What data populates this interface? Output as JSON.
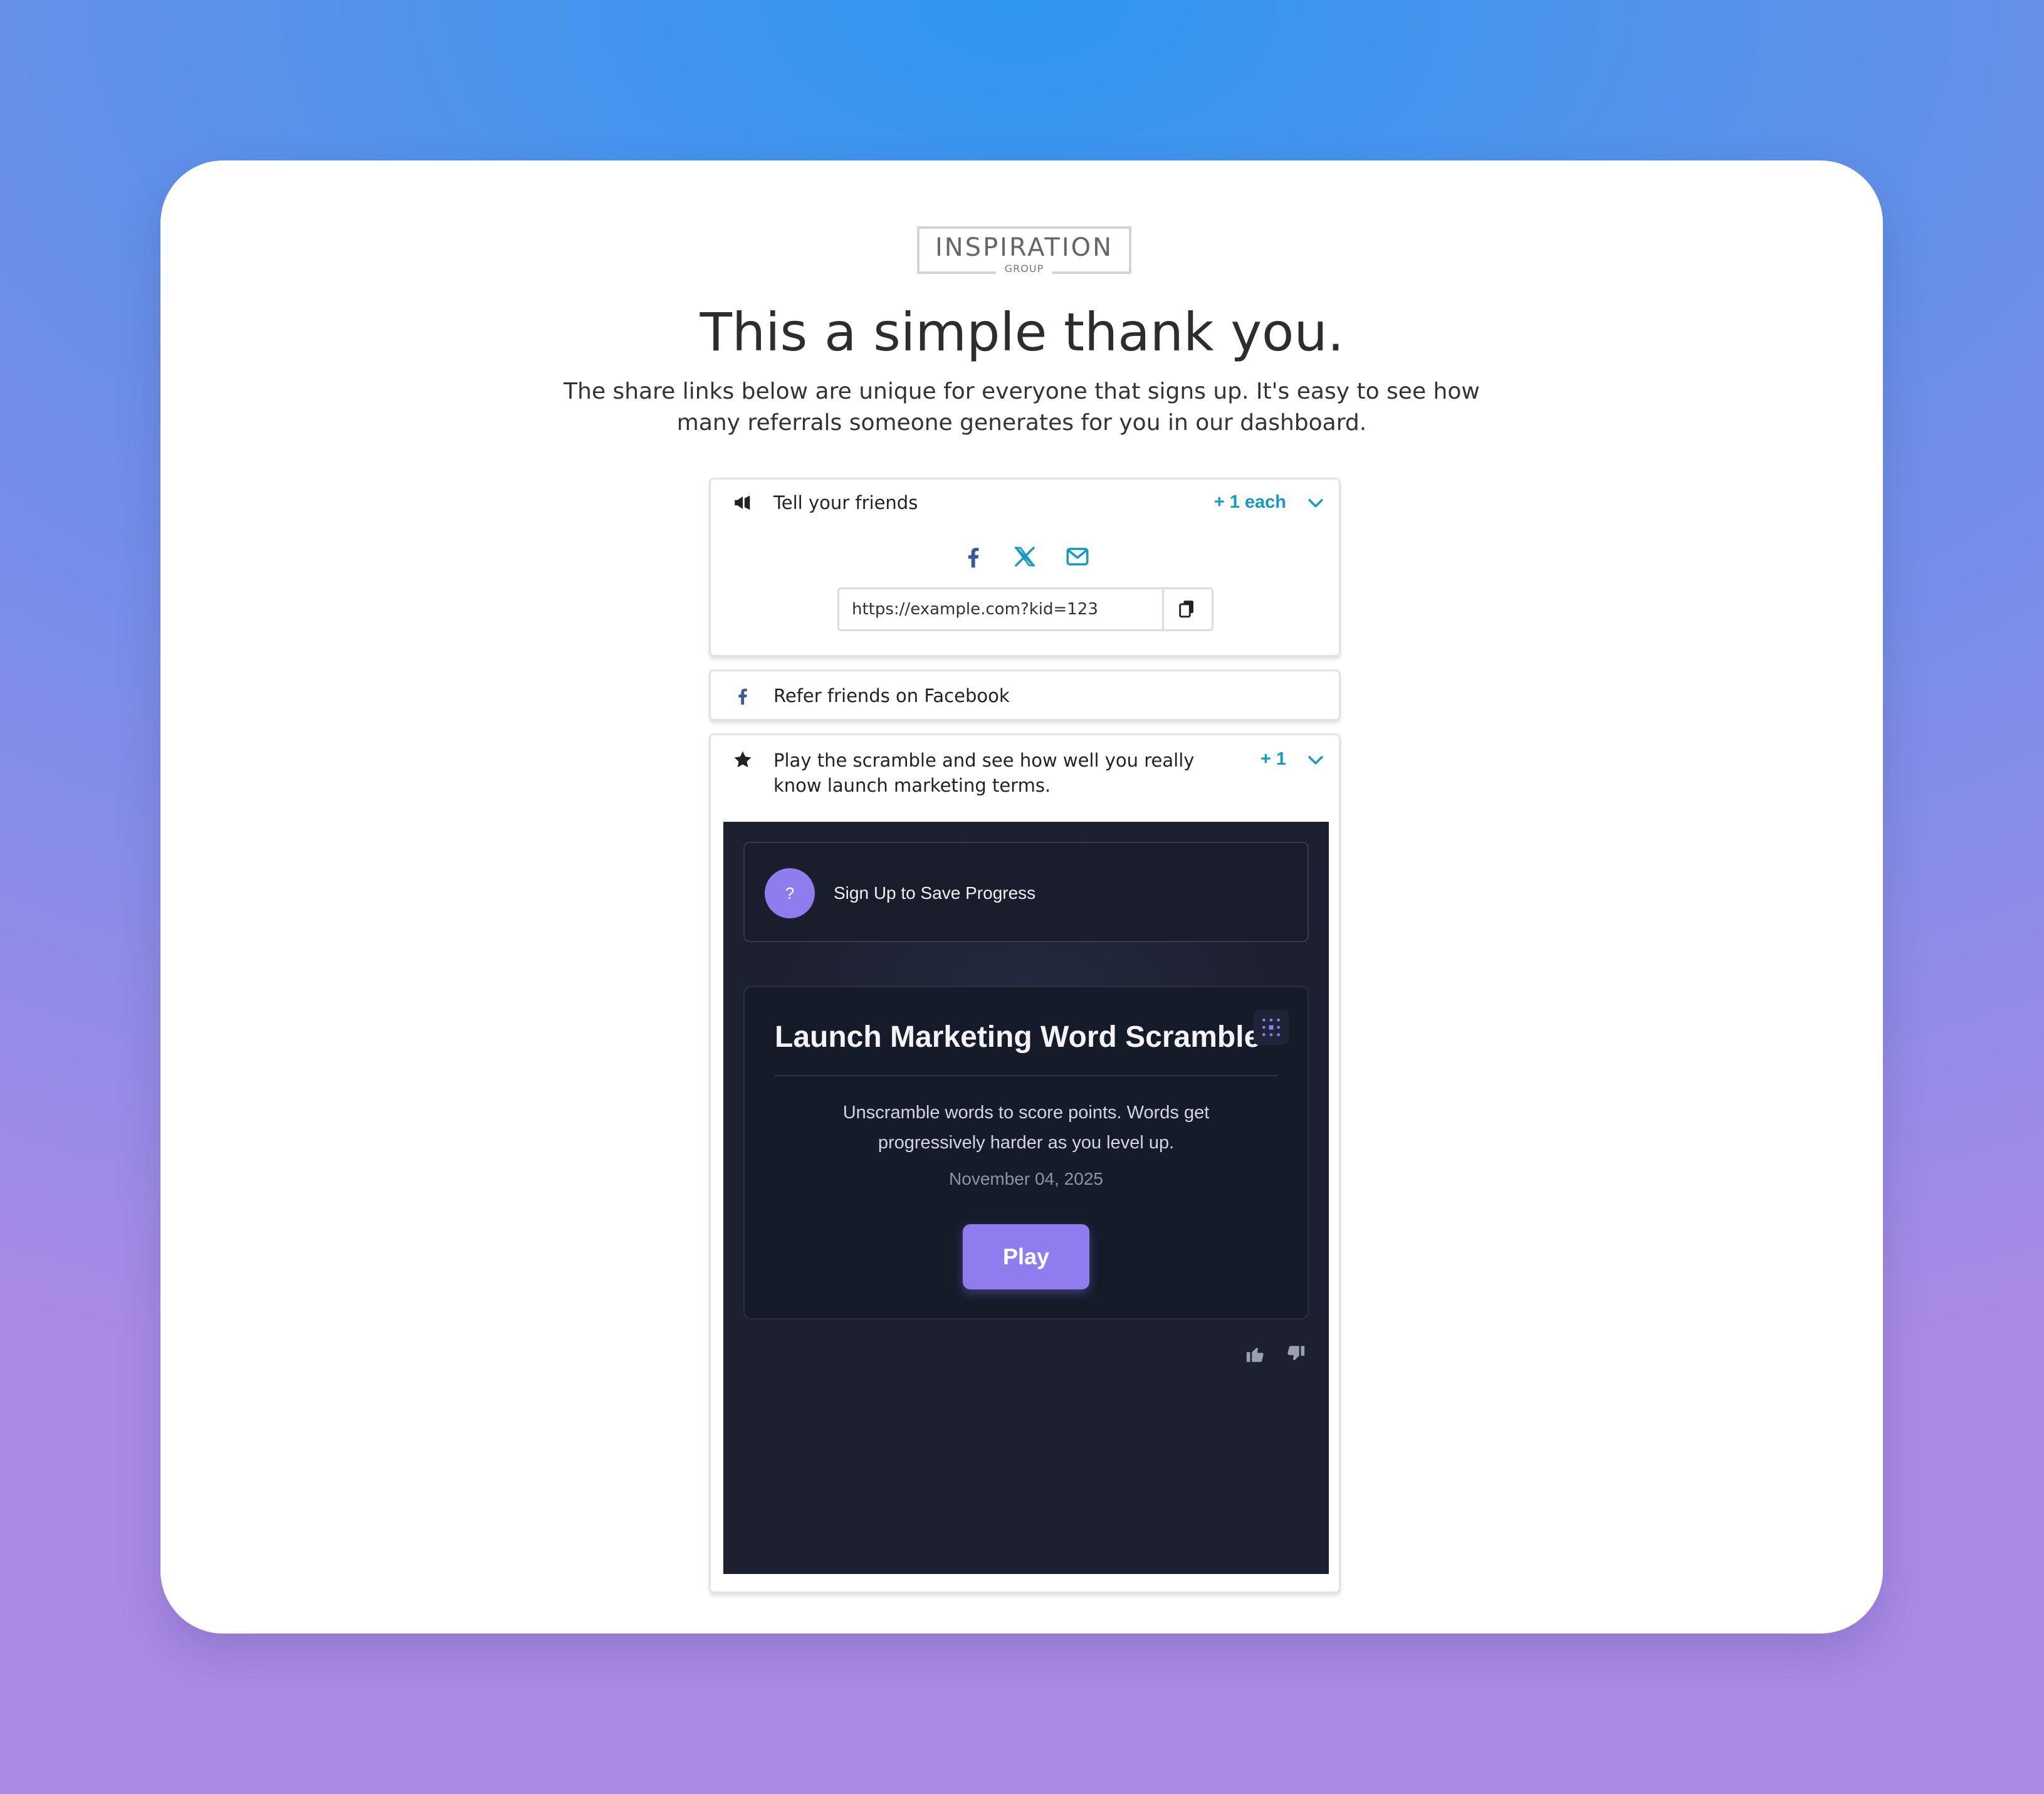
{
  "logo": {
    "main": "INSPIRATION",
    "sub": "GROUP"
  },
  "headline": "This a simple thank you.",
  "subtext": "The share links below are unique for everyone that signs up. It's easy to see how many referrals someone generates for you in our dashboard.",
  "panels": {
    "friends": {
      "icon": "megaphone-icon",
      "label": "Tell your friends",
      "points": "+ 1 each",
      "share_icons": [
        "facebook-icon",
        "x-twitter-icon",
        "envelope-icon"
      ],
      "url": "https://example.com?kid=123"
    },
    "facebook": {
      "icon": "facebook-icon",
      "label": "Refer friends on Facebook"
    },
    "scramble": {
      "icon": "star-icon",
      "label": "Play the scramble and see how well you really know launch marketing terms.",
      "points": "+ 1",
      "game": {
        "signup_avatar": "?",
        "signup_text": "Sign Up to Save Progress",
        "title": "Launch Marketing Word Scramble",
        "description": "Unscramble words to score points. Words get progressively harder as you level up.",
        "date": "November 04, 2025",
        "play_label": "Play"
      }
    }
  },
  "colors": {
    "accent_points": "#139bc6",
    "facebook_blue": "#3b5998",
    "game_purple": "#8f7df0",
    "game_bg": "#1c2030"
  }
}
